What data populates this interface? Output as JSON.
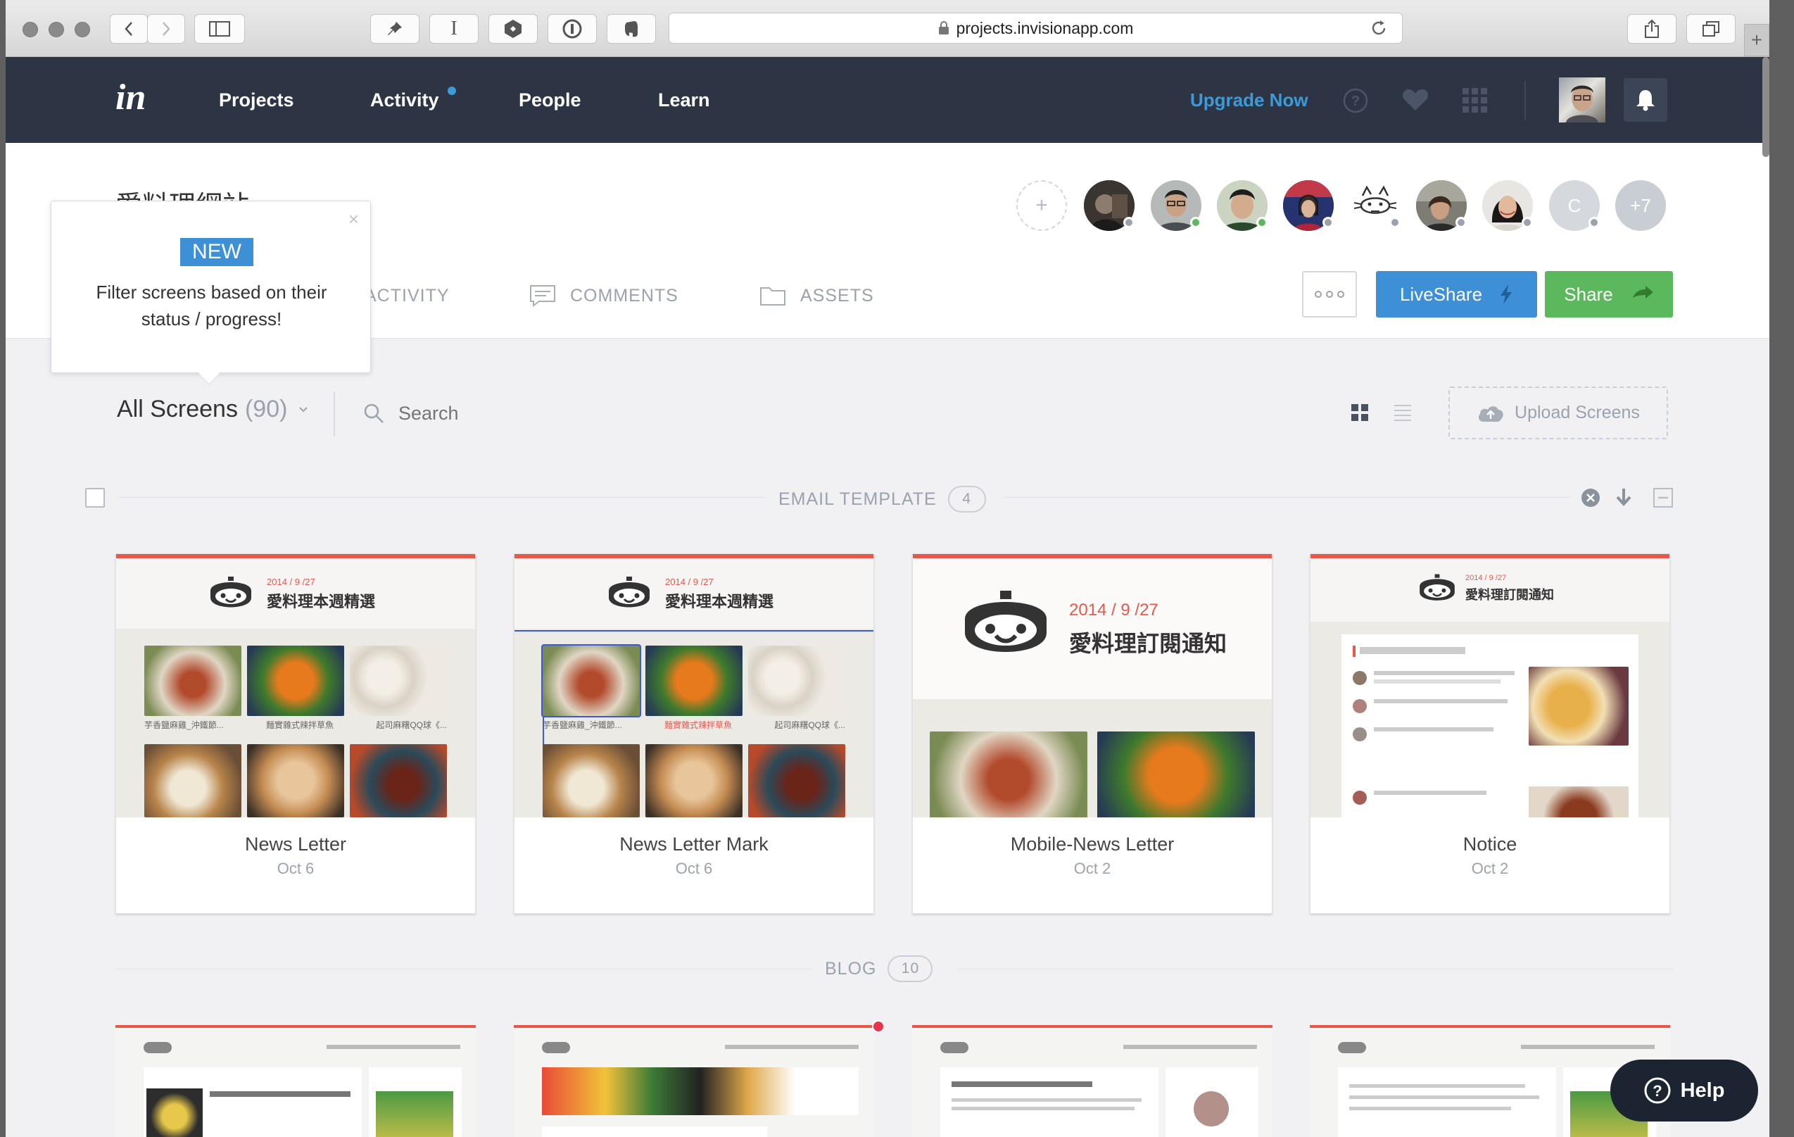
{
  "browser": {
    "url": "projects.invisionapp.com"
  },
  "nav": {
    "logo": "in",
    "links": [
      "Projects",
      "Activity",
      "People",
      "Learn"
    ],
    "upgrade": "Upgrade Now",
    "help_icon": "question-circle-icon",
    "favorite_icon": "heart-icon",
    "apps_icon": "grid-icon",
    "notification_icon": "bell-icon"
  },
  "project": {
    "title": "愛料理網站",
    "more_count": "+7",
    "initial_avatar": "C",
    "tabs": [
      "ACTIVITY",
      "COMMENTS",
      "ASSETS"
    ],
    "liveshare": "LiveShare",
    "share": "Share"
  },
  "tooltip": {
    "badge": "NEW",
    "text": "Filter screens based on their status / progress!"
  },
  "toolbar": {
    "filter_label": "All Screens",
    "filter_count": "(90)",
    "search_placeholder": "Search",
    "upload": "Upload Screens"
  },
  "sections": [
    {
      "name": "EMAIL TEMPLATE",
      "count": "4",
      "screens": [
        {
          "title": "News Letter",
          "date": "Oct 6",
          "thumb_date": "2014 / 9 /27",
          "thumb_heading": "愛料理本週精選"
        },
        {
          "title": "News Letter Mark",
          "date": "Oct 6",
          "thumb_date": "2014 / 9 /27",
          "thumb_heading": "愛料理本週精選"
        },
        {
          "title": "Mobile-News Letter",
          "date": "Oct 2",
          "thumb_date": "2014 / 9 /27",
          "thumb_heading": "愛料理訂閱通知"
        },
        {
          "title": "Notice",
          "date": "Oct 2",
          "thumb_date": "2014 / 9 /27",
          "thumb_heading": "愛料理訂閱通知"
        }
      ]
    },
    {
      "name": "BLOG",
      "count": "10"
    }
  ],
  "help_button": "Help",
  "colors": {
    "nav_bg": "#2d3544",
    "accent_blue": "#3d8fd6",
    "share_green": "#5cb85c",
    "thumb_red": "#e8584a"
  }
}
